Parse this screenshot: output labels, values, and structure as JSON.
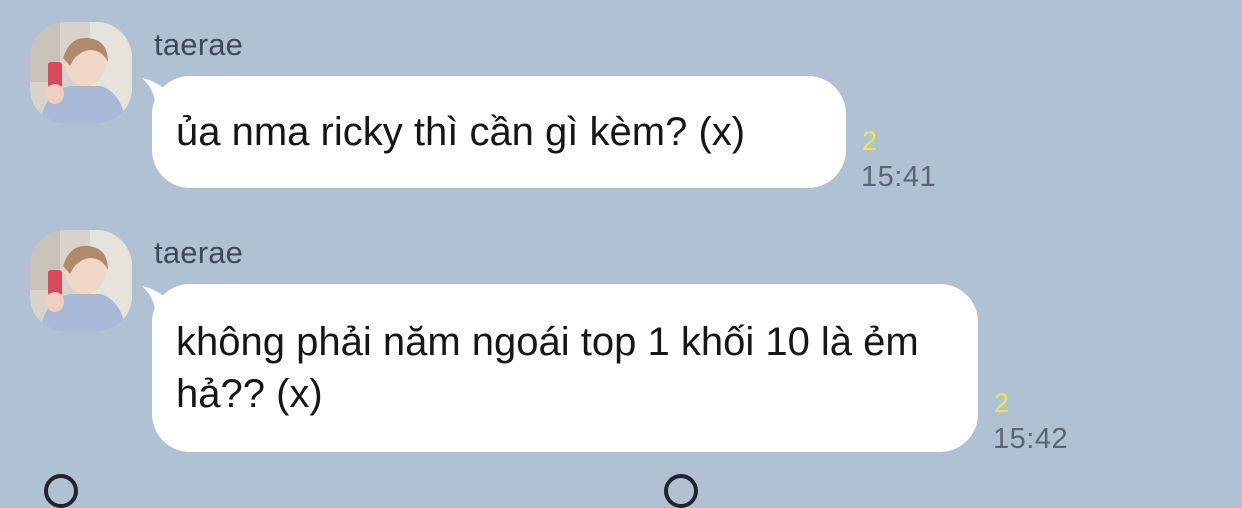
{
  "messages": [
    {
      "sender": "taerae",
      "text": "ủa nma ricky thì cần gì kèm? (x)",
      "unread_count": "2",
      "time": "15:41"
    },
    {
      "sender": "taerae",
      "text": "không phải năm ngoái top 1 khối 10 là ẻm hả?? (x)",
      "unread_count": "2",
      "time": "15:42"
    }
  ],
  "colors": {
    "background": "#afc1d2",
    "bubble": "#ffffff",
    "unread": "#f2e84a",
    "time": "#5d6670"
  },
  "icons": [
    "avatar-photo"
  ]
}
